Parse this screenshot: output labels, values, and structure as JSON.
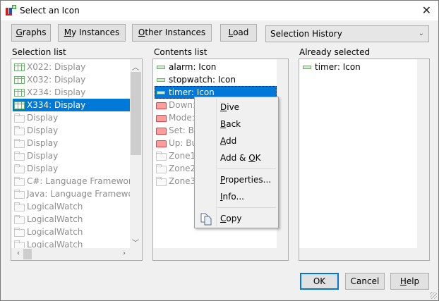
{
  "window": {
    "title": "Select an Icon",
    "close_icon": "close-icon",
    "app_icon": "app-icon"
  },
  "toolbar": {
    "graphs": {
      "label": "Graphs",
      "accel": "G"
    },
    "my_instances": {
      "label": "My Instances",
      "accel": "M"
    },
    "other_instances": {
      "label": "Other Instances",
      "accel": "O"
    },
    "load": {
      "label": "Load",
      "accel": "L"
    },
    "history": {
      "value": "Selection History"
    }
  },
  "selection_list": {
    "label": "Selection list",
    "items": [
      {
        "text": "X022: Display",
        "icon": "display",
        "disabled": true
      },
      {
        "text": "X032: Display",
        "icon": "display",
        "disabled": true
      },
      {
        "text": "X234: Display",
        "icon": "display",
        "disabled": true
      },
      {
        "text": "X334: Display",
        "icon": "display",
        "selected": true
      },
      {
        "text": "Display",
        "icon": "folder",
        "disabled": true
      },
      {
        "text": "Display",
        "icon": "folder",
        "disabled": true
      },
      {
        "text": "Display",
        "icon": "folder",
        "disabled": true
      },
      {
        "text": "Display",
        "icon": "folder",
        "disabled": true
      },
      {
        "text": "Display",
        "icon": "folder",
        "disabled": true
      },
      {
        "text": "C#: Language Framework",
        "icon": "folder",
        "disabled": true
      },
      {
        "text": "Java: Language Framework",
        "icon": "folder",
        "disabled": true
      },
      {
        "text": "LogicalWatch",
        "icon": "folder",
        "disabled": true
      },
      {
        "text": "LogicalWatch",
        "icon": "folder",
        "disabled": true
      },
      {
        "text": "LogicalWatch",
        "icon": "folder",
        "disabled": true
      },
      {
        "text": "LogicalWatch",
        "icon": "folder",
        "disabled": true
      }
    ]
  },
  "contents_list": {
    "label": "Contents list",
    "items": [
      {
        "text": "alarm: Icon",
        "icon": "dash"
      },
      {
        "text": "stopwatch: Icon",
        "icon": "dash"
      },
      {
        "text": "timer: Icon",
        "icon": "dash",
        "selected": true
      },
      {
        "text": "Down:",
        "icon": "button",
        "disabled": true
      },
      {
        "text": "Mode:",
        "icon": "button",
        "disabled": true
      },
      {
        "text": "Set: Bu",
        "icon": "button",
        "disabled": true
      },
      {
        "text": "Up: Bu",
        "icon": "button",
        "disabled": true
      },
      {
        "text": "Zone1:",
        "icon": "folder",
        "disabled": true
      },
      {
        "text": "Zone2:",
        "icon": "folder",
        "disabled": true
      },
      {
        "text": "Zone3:",
        "icon": "folder",
        "disabled": true
      }
    ]
  },
  "already_selected": {
    "label": "Already selected",
    "items": [
      {
        "text": "timer: Icon",
        "icon": "dash"
      }
    ]
  },
  "context_menu": {
    "dive": {
      "label": "Dive",
      "accel": "D"
    },
    "back": {
      "label": "Back",
      "accel": "B"
    },
    "add": {
      "label": "Add",
      "accel": "A"
    },
    "add_ok": {
      "label": "Add & OK",
      "accel": "O"
    },
    "properties": {
      "label": "Properties...",
      "accel": "P"
    },
    "info": {
      "label": "Info...",
      "accel": "I"
    },
    "copy": {
      "label": "Copy",
      "accel": "C"
    }
  },
  "footer": {
    "ok": {
      "label": "OK"
    },
    "cancel": {
      "label": "Cancel"
    },
    "help": {
      "label": "Help",
      "accel": "H"
    }
  },
  "colors": {
    "selection": "#0078d7",
    "disabled_text": "#8d8d8d",
    "dialog_bg": "#f0f0f0"
  }
}
